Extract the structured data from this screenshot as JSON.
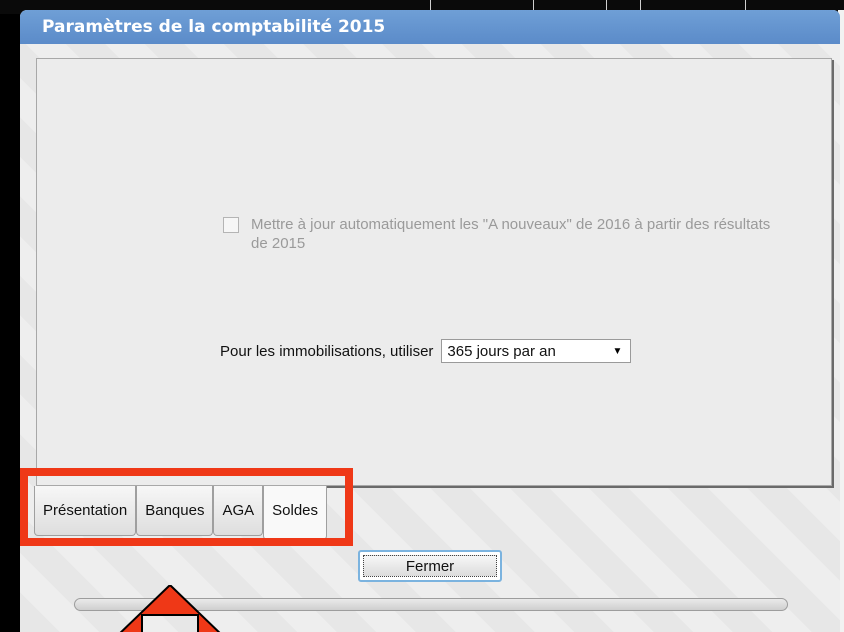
{
  "window": {
    "title": "Paramètres de la comptabilité 2015"
  },
  "settings": {
    "auto_update_label": "Mettre à jour automatiquement les \"A nouveaux\" de 2016 à partir des résultats de 2015",
    "auto_update_checked": false,
    "auto_update_enabled": false,
    "immobilisations_label": "Pour les immobilisations, utiliser",
    "immobilisations_value": "365 jours par an"
  },
  "tabs": [
    {
      "label": "Présentation"
    },
    {
      "label": "Banques"
    },
    {
      "label": "AGA"
    },
    {
      "label": "Soldes",
      "active": true
    }
  ],
  "buttons": {
    "close_label": "Fermer"
  },
  "annotations": {
    "highlight_color": "#ef3817",
    "arrow_color": "#ef3817"
  },
  "colors": {
    "titlebar": "#5b8bc9",
    "focus_border": "#7bb3df"
  }
}
